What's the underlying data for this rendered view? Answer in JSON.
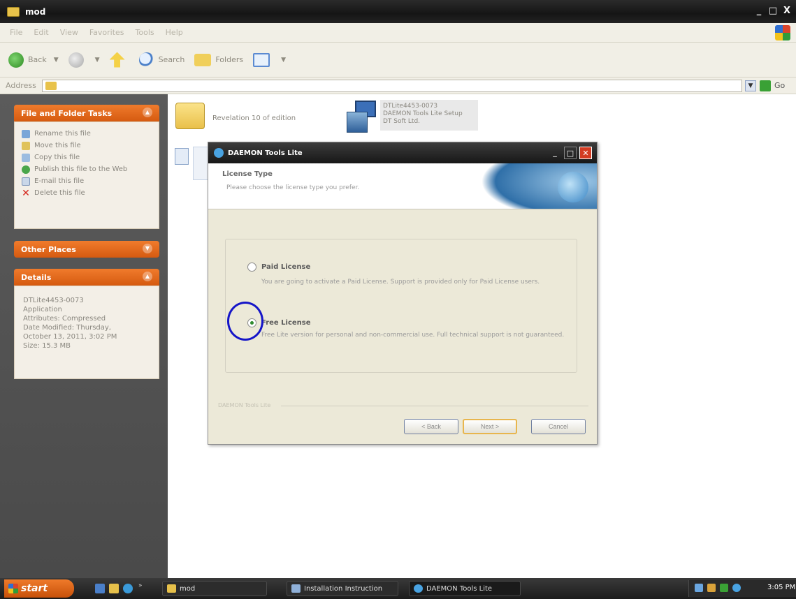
{
  "window": {
    "title": "mod",
    "minimize": "_",
    "maximize": "□",
    "close": "X"
  },
  "menu": {
    "items": [
      "File",
      "Edit",
      "View",
      "Favorites",
      "Tools",
      "Help"
    ]
  },
  "toolbar": {
    "back_label": "Back",
    "search_label": "Search",
    "folders_label": "Folders"
  },
  "address": {
    "label": "Address",
    "go_label": "Go"
  },
  "left_pane": {
    "file_tasks": {
      "title": "File and Folder Tasks",
      "items": [
        {
          "label": "Rename this file",
          "icon": "rename-icon"
        },
        {
          "label": "Move this file",
          "icon": "move-icon"
        },
        {
          "label": "Copy this file",
          "icon": "copy-icon"
        },
        {
          "label": "Publish this file to the Web",
          "icon": "publish-icon"
        },
        {
          "label": "E-mail this file",
          "icon": "email-icon"
        },
        {
          "label": "Delete this file",
          "icon": "delete-icon"
        }
      ]
    },
    "other_places": {
      "title": "Other Places"
    },
    "details": {
      "title": "Details",
      "lines": [
        "DTLite4453-0073",
        "Application",
        "Attributes: Compressed",
        "Date Modified: Thursday,",
        "October 13, 2011, 3:02 PM",
        "Size: 15.3 MB"
      ]
    }
  },
  "files": {
    "folder_name": "Revelation 10 of edition",
    "setup_lines": [
      "DTLite4453-0073",
      "DAEMON Tools Lite Setup",
      "DT Soft Ltd."
    ]
  },
  "dialog": {
    "title": "DAEMON Tools Lite",
    "header_title": "License Type",
    "header_subtitle": "Please choose the license type you prefer.",
    "options": [
      {
        "title": "Paid License",
        "description": "You are going to activate a Paid License. Support is provided only for Paid License users.",
        "checked": false
      },
      {
        "title": "Free License",
        "description": "Free Lite version for personal and non-commercial use. Full technical support is not guaranteed.",
        "checked": true
      }
    ],
    "footer_brand": "DAEMON Tools Lite",
    "buttons": {
      "back": "< Back",
      "next": "Next >",
      "cancel": "Cancel"
    }
  },
  "taskbar": {
    "start_label": "start",
    "tasks": [
      {
        "label": "mod",
        "icon": "folder-icon"
      },
      {
        "label": "Installation Instruction",
        "icon": "document-icon"
      },
      {
        "label": "DAEMON Tools Lite",
        "icon": "daemon-tools-icon"
      }
    ],
    "clock": "3:05 PM"
  },
  "colors": {
    "accent_orange": "#e8661b",
    "titlebar_dark": "#1c1c1c",
    "annotation_blue": "#1515c8"
  }
}
